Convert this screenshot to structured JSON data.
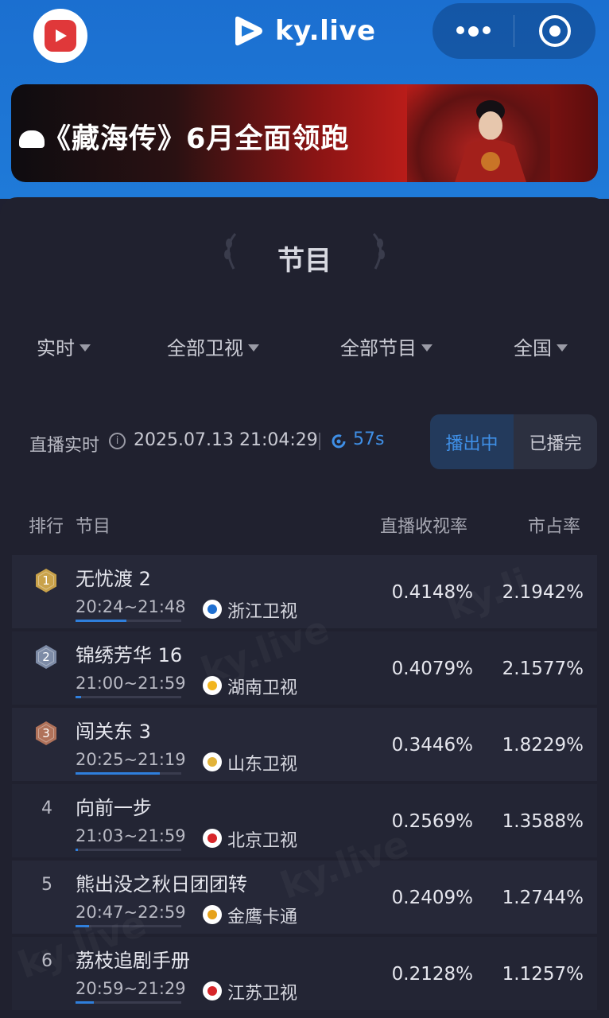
{
  "header": {
    "brand": "ky.live",
    "app_icon": "play-logo-icon",
    "menu_icon": "more-dots-icon",
    "close_icon": "target-circle-icon",
    "accent": "#1f7ad8"
  },
  "banner": {
    "text": "《藏海传》6月全面领跑"
  },
  "panel": {
    "title": "节目"
  },
  "filters": [
    {
      "label": "实时"
    },
    {
      "label": "全部卫视"
    },
    {
      "label": "全部节目"
    },
    {
      "label": "全国"
    }
  ],
  "status": {
    "live_label": "直播实时",
    "datetime": "2025.07.13 21:04:29",
    "refresh": "57s",
    "seg_on": "播出中",
    "seg_off": "已播完",
    "accent": "#3f8fe6"
  },
  "table": {
    "headers": {
      "rank": "排行",
      "program": "节目",
      "rating": "直播收视率",
      "share": "市占率"
    },
    "rows": [
      {
        "rank": "1",
        "name": "无忧渡 2",
        "time": "20:24~21:48",
        "progress": 0.48,
        "channel": "浙江卫视",
        "rating": "0.4148%",
        "share": "2.1942%",
        "medal": "gold"
      },
      {
        "rank": "2",
        "name": "锦绣芳华 16",
        "time": "21:00~21:59",
        "progress": 0.05,
        "channel": "湖南卫视",
        "rating": "0.4079%",
        "share": "2.1577%",
        "medal": "silver"
      },
      {
        "rank": "3",
        "name": "闯关东 3",
        "time": "20:25~21:19",
        "progress": 0.8,
        "channel": "山东卫视",
        "rating": "0.3446%",
        "share": "1.8229%",
        "medal": "bronze"
      },
      {
        "rank": "4",
        "name": "向前一步",
        "time": "21:03~21:59",
        "progress": 0.02,
        "channel": "北京卫视",
        "rating": "0.2569%",
        "share": "1.3588%",
        "medal": ""
      },
      {
        "rank": "5",
        "name": "熊出没之秋日团团转",
        "time": "20:47~22:59",
        "progress": 0.13,
        "channel": "金鹰卡通",
        "rating": "0.2409%",
        "share": "1.2744%",
        "medal": ""
      },
      {
        "rank": "6",
        "name": "荔枝追剧手册",
        "time": "20:59~21:29",
        "progress": 0.17,
        "channel": "江苏卫视",
        "rating": "0.2128%",
        "share": "1.1257%",
        "medal": ""
      }
    ]
  }
}
